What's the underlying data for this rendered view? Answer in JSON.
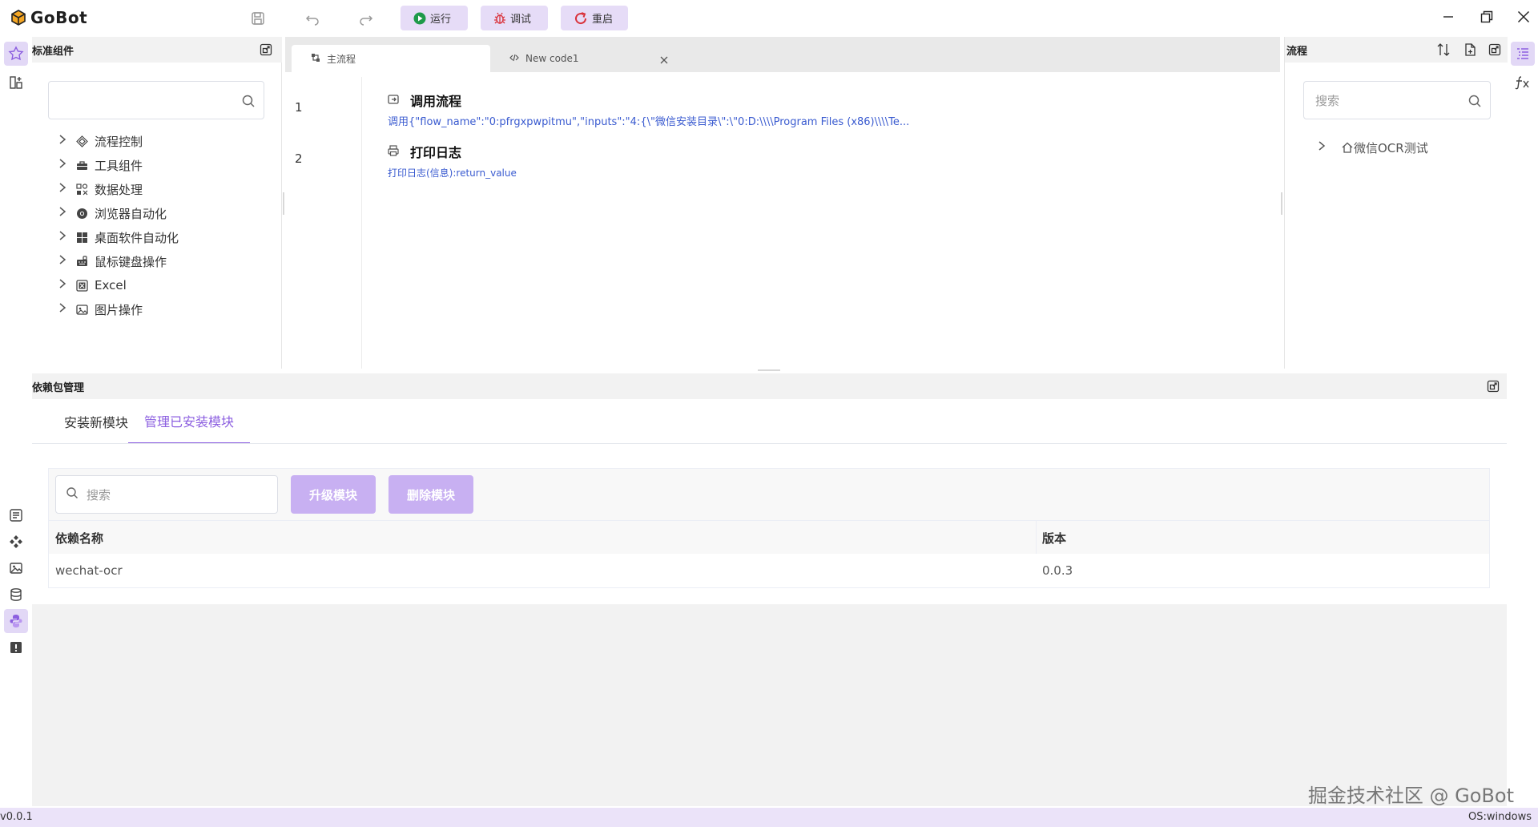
{
  "app": {
    "title": "GoBot"
  },
  "toolbar": {
    "run_label": "运行",
    "debug_label": "调试",
    "restart_label": "重启"
  },
  "components": {
    "title": "标准组件",
    "search_placeholder": "",
    "items": [
      {
        "label": "流程控制",
        "icon": "diamond-icon"
      },
      {
        "label": "工具组件",
        "icon": "toolbox-icon"
      },
      {
        "label": "数据处理",
        "icon": "data-icon"
      },
      {
        "label": "浏览器自动化",
        "icon": "chrome-icon"
      },
      {
        "label": "桌面软件自动化",
        "icon": "windows-icon"
      },
      {
        "label": "鼠标键盘操作",
        "icon": "keyboard-icon"
      },
      {
        "label": "Excel",
        "icon": "excel-icon"
      },
      {
        "label": "图片操作",
        "icon": "image-icon"
      }
    ]
  },
  "editor": {
    "tabs": [
      {
        "label": "主流程"
      },
      {
        "label": "New code1"
      }
    ],
    "steps": [
      {
        "line": "1",
        "title": "调用流程",
        "desc": "调用{\"flow_name\":\"0:pfrgxpwpitmu\",\"inputs\":\"4:{\\\"微信安装目录\\\":\\\"0:D:\\\\\\\\Program Files (x86)\\\\\\\\Te..."
      },
      {
        "line": "2",
        "title": "打印日志",
        "desc": "打印日志(信息):return_value"
      }
    ]
  },
  "flows": {
    "title": "流程",
    "search_placeholder": "搜索",
    "items": [
      {
        "label": "微信OCR测试"
      }
    ]
  },
  "dependencies": {
    "title": "依赖包管理",
    "tabs": [
      {
        "label": "安装新模块"
      },
      {
        "label": "管理已安装模块"
      }
    ],
    "search_placeholder": "搜索",
    "upgrade_label": "升级模块",
    "delete_label": "删除模块",
    "columns": [
      "依赖名称",
      "版本"
    ],
    "rows": [
      {
        "name": "wechat-ocr",
        "version": "0.0.3"
      }
    ]
  },
  "status": {
    "version": "v0.0.1",
    "os": "OS:windows"
  },
  "watermark": "掘金技术社区 @ GoBot",
  "colors": {
    "accent": "#8c5fe0",
    "accent_light": "#e2d8f6",
    "button_disabled": "#c8b0f2",
    "link": "#3a5bd0"
  }
}
